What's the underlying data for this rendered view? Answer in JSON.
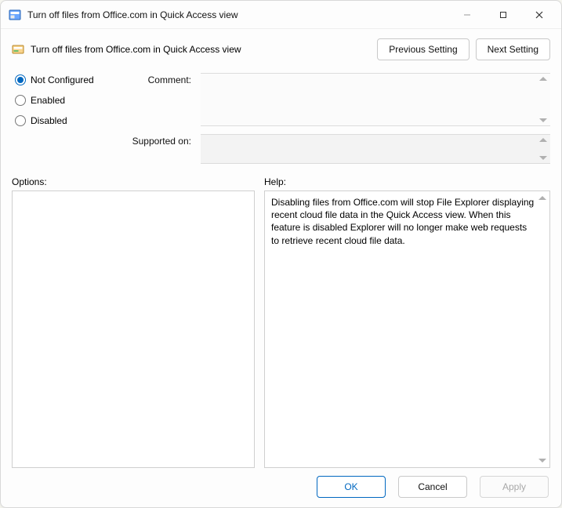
{
  "window": {
    "title": "Turn off files from Office.com in Quick Access view"
  },
  "header": {
    "setting_title": "Turn off files from Office.com in Quick Access view",
    "prev_button": "Previous Setting",
    "next_button": "Next Setting"
  },
  "state": {
    "options": [
      {
        "id": "not-configured",
        "label": "Not Configured",
        "selected": true
      },
      {
        "id": "enabled",
        "label": "Enabled",
        "selected": false
      },
      {
        "id": "disabled",
        "label": "Disabled",
        "selected": false
      }
    ]
  },
  "fields": {
    "comment_label": "Comment:",
    "comment_value": "",
    "supported_label": "Supported on:",
    "supported_value": ""
  },
  "sections": {
    "options_label": "Options:",
    "help_label": "Help:",
    "help_text": "Disabling files from Office.com will stop File Explorer displaying recent cloud file data in the Quick Access view. When this feature is disabled Explorer will no longer make web requests to retrieve recent cloud file data."
  },
  "footer": {
    "ok": "OK",
    "cancel": "Cancel",
    "apply": "Apply"
  }
}
